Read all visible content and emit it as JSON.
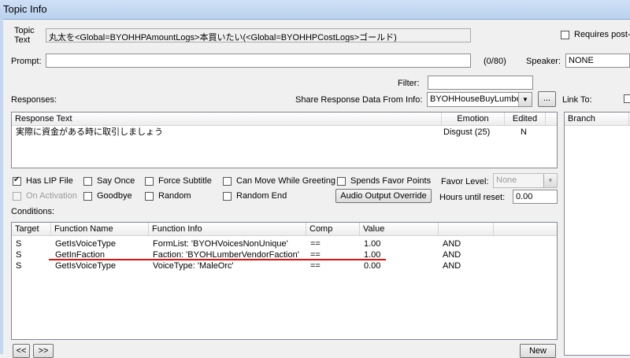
{
  "window": {
    "title": "Topic Info"
  },
  "topic": {
    "label": "Topic\nText",
    "value": "丸太を<Global=BYOHHPAmountLogs>本買いたい(<Global=BYOHHPCostLogs>ゴールド)",
    "requires_post": "Requires post-"
  },
  "prompt": {
    "label": "Prompt:",
    "value": "",
    "counter": "(0/80)"
  },
  "speaker": {
    "label": "Speaker:",
    "value": "NONE"
  },
  "filter": {
    "label": "Filter:",
    "value": ""
  },
  "responses": {
    "label": "Responses:",
    "share_label": "Share Response Data From Info:",
    "share_value": "BYOHHouseBuyLumberI",
    "more_button": "...",
    "columns": [
      "Response Text",
      "Emotion",
      "Edited"
    ],
    "rows": [
      [
        "実際に資金がある時に取引しましょう",
        "Disgust (25)",
        "N"
      ]
    ]
  },
  "link_to": {
    "label": "Link To:",
    "column": "Branch"
  },
  "options": {
    "has_lip": "Has LIP File",
    "say_once": "Say Once",
    "force_subtitle": "Force Subtitle",
    "can_move": "Can Move While Greeting",
    "spends_favor": "Spends Favor Points",
    "favor_level_label": "Favor Level:",
    "favor_level_value": "None",
    "on_activation": "On Activation",
    "goodbye": "Goodbye",
    "random": "Random",
    "random_end": "Random End",
    "audio_override": "Audio Output Override",
    "hours_label": "Hours until reset:",
    "hours_value": "0.00"
  },
  "conditions": {
    "label": "Conditions:",
    "columns": [
      "Target",
      "Function Name",
      "Function Info",
      "Comp",
      "Value",
      ""
    ],
    "rows": [
      [
        "S",
        "GetIsVoiceType",
        "FormList: 'BYOHVoicesNonUnique'",
        "==",
        "1.00",
        "AND"
      ],
      [
        "S",
        "GetInFaction",
        "Faction: 'BYOHLumberVendorFaction'",
        "==",
        "1.00",
        "AND"
      ],
      [
        "S",
        "GetIsVoiceType",
        "VoiceType: 'MaleOrc'",
        "==",
        "0.00",
        "AND"
      ]
    ],
    "highlight_color": "#e01010"
  },
  "footer": {
    "prev": "<<",
    "next": ">>",
    "new": "New"
  }
}
